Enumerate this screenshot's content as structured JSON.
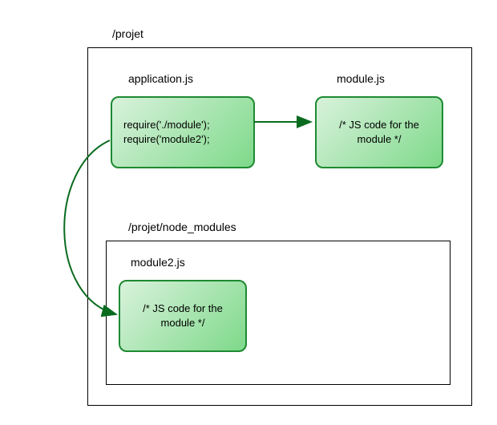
{
  "diagram": {
    "outer_label": "/projet",
    "app_label": "application.js",
    "app_code_line1": "require('./module');",
    "app_code_line2": "require('module2');",
    "module_label": "module.js",
    "module_code": "/* JS code for the module */",
    "nm_label": "/projet/node_modules",
    "module2_label": "module2.js",
    "module2_code": "/* JS code for the module */"
  },
  "colors": {
    "box_border": "#1e8a32",
    "arrow": "#0a6b1f"
  }
}
